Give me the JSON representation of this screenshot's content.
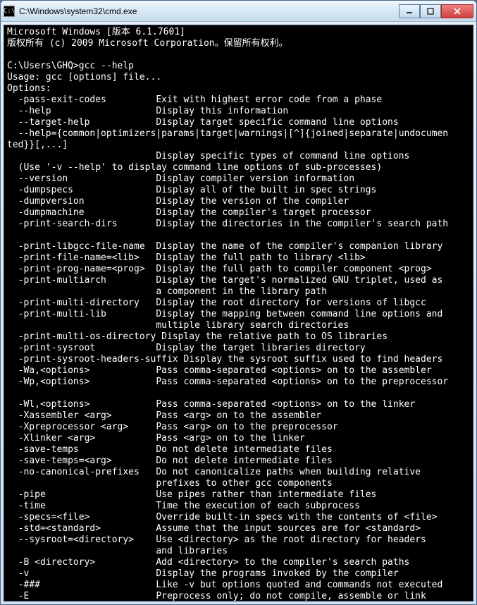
{
  "window": {
    "title": "C:\\Windows\\system32\\cmd.exe",
    "icon_label": "C:\\"
  },
  "buttons": {
    "minimize": "minimize-button",
    "maximize": "maximize-button",
    "close": "close-button"
  },
  "console_lines": [
    "Microsoft Windows [版本 6.1.7601]",
    "版权所有 (c) 2009 Microsoft Corporation。保留所有权利。",
    "",
    "C:\\Users\\GHQ>gcc --help",
    "Usage: gcc [options] file...",
    "Options:",
    "  -pass-exit-codes         Exit with highest error code from a phase",
    "  --help                   Display this information",
    "  --target-help            Display target specific command line options",
    "  --help={common|optimizers|params|target|warnings|[^]{joined|separate|undocumen",
    "ted}}[,...]",
    "                           Display specific types of command line options",
    "  (Use '-v --help' to display command line options of sub-processes)",
    "  --version                Display compiler version information",
    "  -dumpspecs               Display all of the built in spec strings",
    "  -dumpversion             Display the version of the compiler",
    "  -dumpmachine             Display the compiler's target processor",
    "  -print-search-dirs       Display the directories in the compiler's search path",
    "",
    "  -print-libgcc-file-name  Display the name of the compiler's companion library",
    "  -print-file-name=<lib>   Display the full path to library <lib>",
    "  -print-prog-name=<prog>  Display the full path to compiler component <prog>",
    "  -print-multiarch         Display the target's normalized GNU triplet, used as",
    "                           a component in the library path",
    "  -print-multi-directory   Display the root directory for versions of libgcc",
    "  -print-multi-lib         Display the mapping between command line options and",
    "                           multiple library search directories",
    "  -print-multi-os-directory Display the relative path to OS libraries",
    "  -print-sysroot           Display the target libraries directory",
    "  -print-sysroot-headers-suffix Display the sysroot suffix used to find headers",
    "  -Wa,<options>            Pass comma-separated <options> on to the assembler",
    "  -Wp,<options>            Pass comma-separated <options> on to the preprocessor",
    "",
    "  -Wl,<options>            Pass comma-separated <options> on to the linker",
    "  -Xassembler <arg>        Pass <arg> on to the assembler",
    "  -Xpreprocessor <arg>     Pass <arg> on to the preprocessor",
    "  -Xlinker <arg>           Pass <arg> on to the linker",
    "  -save-temps              Do not delete intermediate files",
    "  -save-temps=<arg>        Do not delete intermediate files",
    "  -no-canonical-prefixes   Do not canonicalize paths when building relative",
    "                           prefixes to other gcc components",
    "  -pipe                    Use pipes rather than intermediate files",
    "  -time                    Time the execution of each subprocess",
    "  -specs=<file>            Override built-in specs with the contents of <file>",
    "  -std=<standard>          Assume that the input sources are for <standard>",
    "  --sysroot=<directory>    Use <directory> as the root directory for headers",
    "                           and libraries",
    "  -B <directory>           Add <directory> to the compiler's search paths",
    "  -v                       Display the programs invoked by the compiler",
    "  -###                     Like -v but options quoted and commands not executed",
    "  -E                       Preprocess only; do not compile, assemble or link"
  ]
}
